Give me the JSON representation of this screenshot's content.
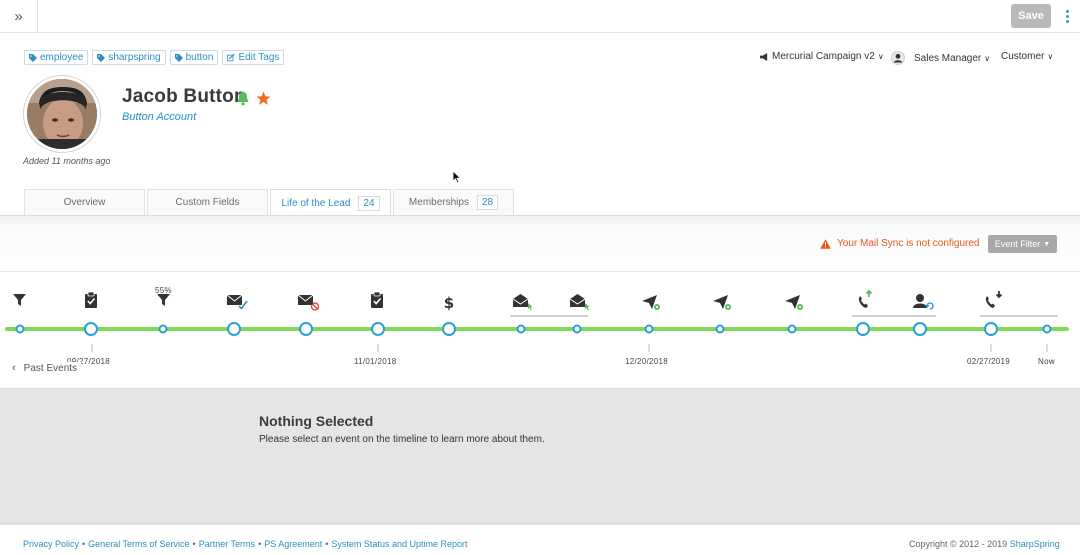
{
  "topbar": {
    "collapse_glyph": "»",
    "save_label": "Save"
  },
  "tags": [
    {
      "label": "employee"
    },
    {
      "label": "sharpspring"
    },
    {
      "label": "button"
    },
    {
      "label": "Edit Tags"
    }
  ],
  "profile": {
    "name": "Jacob Button",
    "account": "Button Account",
    "added": "Added 11 months ago"
  },
  "header_menus": {
    "campaign": "Mercurial Campaign v2",
    "role": "Sales Manager",
    "type": "Customer"
  },
  "tabs": [
    {
      "label": "Overview",
      "count": ""
    },
    {
      "label": "Custom Fields",
      "count": ""
    },
    {
      "label": "Life of the Lead",
      "count": "24",
      "active": true
    },
    {
      "label": "Memberships",
      "count": "28"
    }
  ],
  "mail_sync": {
    "warning": "Your Mail Sync is not configured",
    "filter_label": "Event Filter"
  },
  "timeline": {
    "funnel_percent": "55%",
    "dates": [
      "09/27/2018",
      "11/01/2018",
      "12/20/2018",
      "02/27/2019",
      "Now"
    ],
    "past_events_label": "Past Events",
    "icons": [
      "filter-icon",
      "clipboard-check-icon",
      "filter-icon",
      "email-check-icon",
      "email-blocked-icon",
      "clipboard-check-icon",
      "dollar-icon",
      "email-open-icon",
      "email-open-icon",
      "send-gear-icon",
      "send-gear-icon",
      "send-gear-icon",
      "phone-outbound-icon",
      "user-sync-icon",
      "phone-inbound-icon"
    ]
  },
  "detail": {
    "title": "Nothing Selected",
    "subtitle": "Please select an event on the timeline to learn more about them."
  },
  "footer": {
    "links": [
      "Privacy Policy",
      "General Terms of Service",
      "Partner Terms",
      "PS Agreement",
      "System Status and Uptime Report"
    ],
    "separator": "•",
    "copyright_prefix": "Copyright © 2012 - 2019",
    "brand": "SharpSpring"
  },
  "colors": {
    "accent": "#2a8fc4",
    "timeline_line": "#7ed957",
    "warning": "#e35a1d",
    "icon_green": "#5cb85c"
  }
}
